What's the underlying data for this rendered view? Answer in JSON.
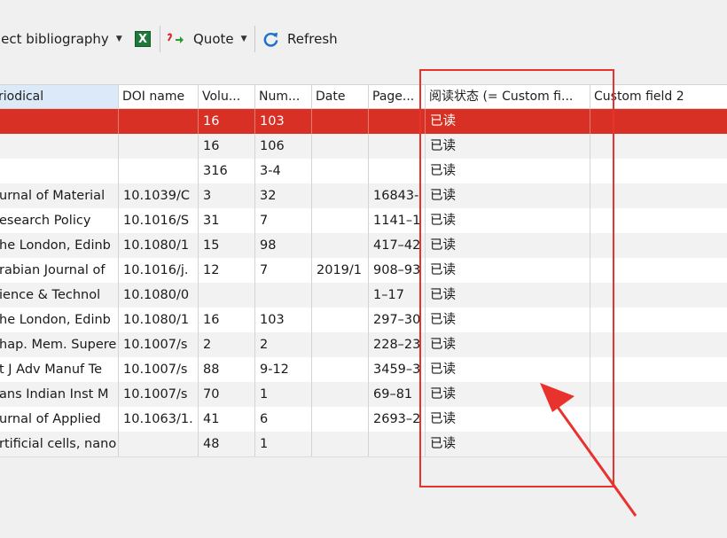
{
  "toolbar": {
    "subject_bibliography": "ject bibliography",
    "quote": "Quote",
    "refresh": "Refresh",
    "excel_glyph": "X"
  },
  "table": {
    "headers": [
      "riodical",
      "DOI name",
      "Volu...",
      "Num...",
      "Date",
      "Page...",
      "阅读状态 (= Custom fi...",
      "Custom field 2"
    ],
    "rows": [
      {
        "periodical": "",
        "doi": "",
        "volume": "16",
        "number": "103",
        "date": "",
        "pages": "",
        "status": "已读",
        "custom2": "",
        "selected": true
      },
      {
        "periodical": "",
        "doi": "",
        "volume": "16",
        "number": "106",
        "date": "",
        "pages": "",
        "status": "已读",
        "custom2": ""
      },
      {
        "periodical": "",
        "doi": "",
        "volume": "316",
        "number": "3-4",
        "date": "",
        "pages": "",
        "status": "已读",
        "custom2": ""
      },
      {
        "periodical": "urnal of Material",
        "doi": "10.1039/C",
        "volume": "3",
        "number": "32",
        "date": "",
        "pages": "16843-",
        "status": "已读",
        "custom2": ""
      },
      {
        "periodical": "esearch Policy",
        "doi": "10.1016/S",
        "volume": "31",
        "number": "7",
        "date": "",
        "pages": "1141–1",
        "status": "已读",
        "custom2": ""
      },
      {
        "periodical": "he London, Edinb",
        "doi": "10.1080/1",
        "volume": "15",
        "number": "98",
        "date": "",
        "pages": "417–42",
        "status": "已读",
        "custom2": ""
      },
      {
        "periodical": "rabian Journal of",
        "doi": "10.1016/j.",
        "volume": "12",
        "number": "7",
        "date": "2019/1",
        "pages": "908–93",
        "status": "已读",
        "custom2": ""
      },
      {
        "periodical": "ience & Technol",
        "doi": "10.1080/0",
        "volume": "",
        "number": "",
        "date": "",
        "pages": "1–17",
        "status": "已读",
        "custom2": ""
      },
      {
        "periodical": "he London, Edinb",
        "doi": "10.1080/1",
        "volume": "16",
        "number": "103",
        "date": "",
        "pages": "297–30",
        "status": "已读",
        "custom2": ""
      },
      {
        "periodical": "hap. Mem. Supere",
        "doi": "10.1007/s",
        "volume": "2",
        "number": "2",
        "date": "",
        "pages": "228–23",
        "status": "已读",
        "custom2": ""
      },
      {
        "periodical": "t J Adv Manuf Te",
        "doi": "10.1007/s",
        "volume": "88",
        "number": "9-12",
        "date": "",
        "pages": "3459–3",
        "status": "已读",
        "custom2": ""
      },
      {
        "periodical": "ans Indian Inst M",
        "doi": "10.1007/s",
        "volume": "70",
        "number": "1",
        "date": "",
        "pages": "69–81",
        "status": "已读",
        "custom2": ""
      },
      {
        "periodical": "urnal of Applied",
        "doi": "10.1063/1.",
        "volume": "41",
        "number": "6",
        "date": "",
        "pages": "2693–2",
        "status": "已读",
        "custom2": ""
      },
      {
        "periodical": "rtificial cells, nano",
        "doi": "",
        "volume": "48",
        "number": "1",
        "date": "",
        "pages": "",
        "status": "已读",
        "custom2": ""
      }
    ]
  },
  "colors": {
    "selected_row": "#d93025",
    "annotation_red": "#e8322e",
    "active_header": "#dbe9f8"
  },
  "icons": {
    "excel": "excel-icon",
    "quote": "quote-icon",
    "refresh": "refresh-icon",
    "dropdown": "chevron-down-icon"
  }
}
